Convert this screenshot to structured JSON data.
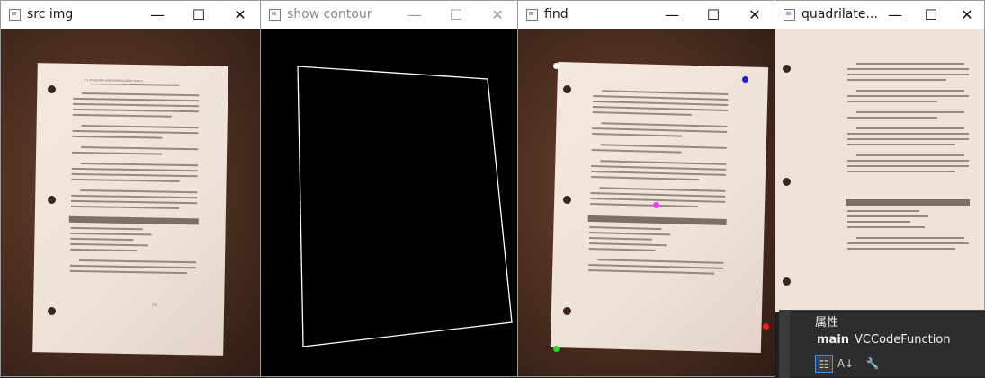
{
  "windows": {
    "src": {
      "title": "src img"
    },
    "contour": {
      "title": "show contour"
    },
    "find": {
      "title": "find"
    },
    "quad": {
      "title": "quadrilate..."
    }
  },
  "controls": {
    "minimize": "—",
    "maximize": "☐",
    "close": "✕"
  },
  "doc_text": {
    "header": "4.1 ACCESSING AND MANIPULATING PIXELS",
    "para1": "On Line 14 we manipulate the top-left pixel in the image, which is located at coordinate (0,0) and set it to have a value of (0, 0, 255). If we were reading this pixel value in RGB format, we would have a value of 0 for red, 0 for green, and 255 for blue, thus making it a pure blue color.",
    "band": "Listing 4.1 getting_and_setting.py",
    "footer": "22"
  },
  "find_points": {
    "colors": {
      "top_left": "#ffffff",
      "top_right": "#1a1aff",
      "bottom_right": "#ff1a1a",
      "bottom_left": "#22dd22",
      "center": "#ff33ff"
    }
  },
  "vs_panel": {
    "title": "属性",
    "object_kind": "main",
    "object_type": "VCCodeFunction",
    "tools": [
      "categorized-icon",
      "alphabetical-icon",
      "wrench-icon"
    ]
  }
}
